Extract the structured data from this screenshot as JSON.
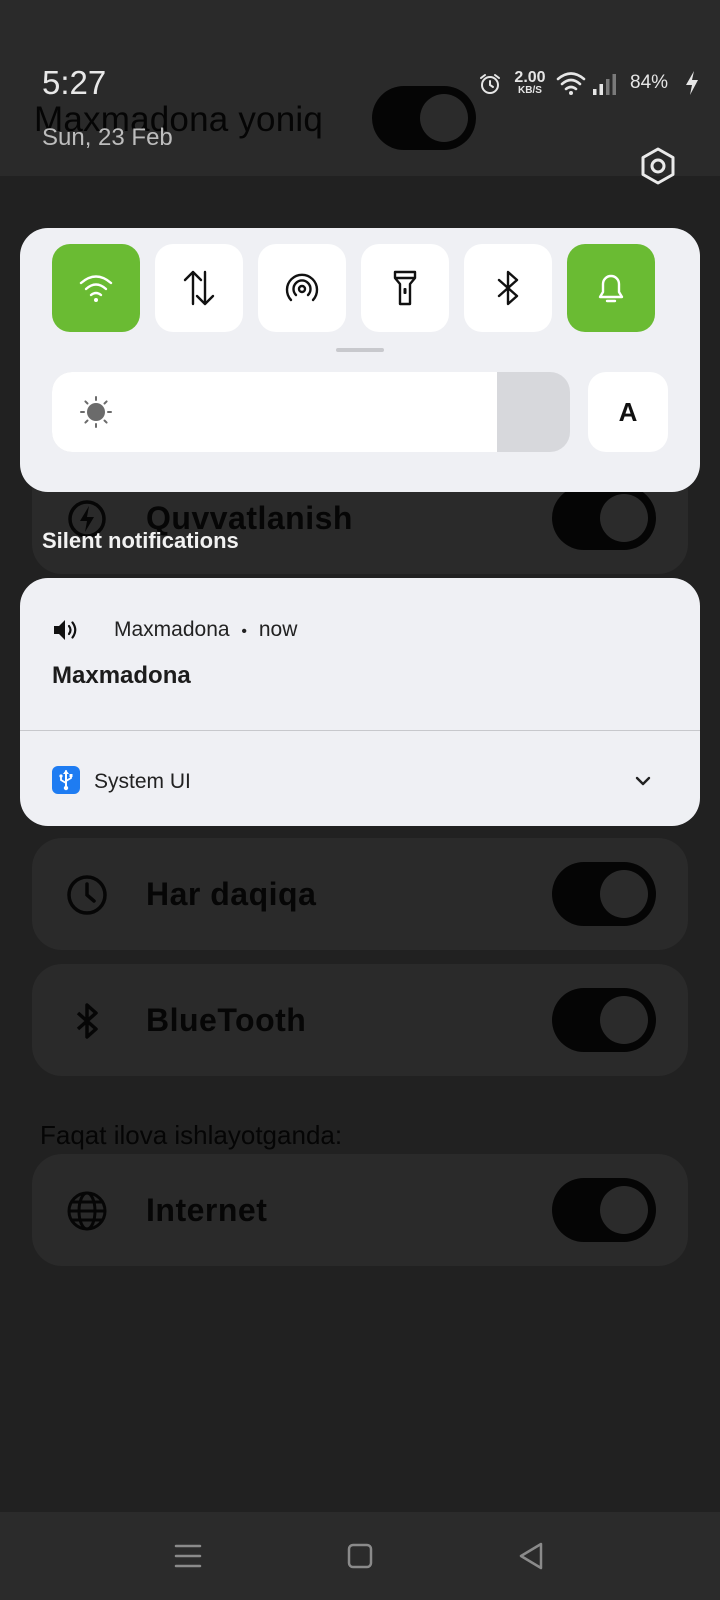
{
  "status_bar": {
    "time": "5:27",
    "date": "Sun, 23 Feb",
    "net_speed_value": "2.00",
    "net_speed_unit": "KB/S",
    "battery": "84%",
    "icons": [
      "alarm-icon",
      "wifi-icon",
      "signal-icon",
      "charging-icon"
    ]
  },
  "app": {
    "title": "Maxmadona yoniq",
    "cards": [
      {
        "label": "Quvvatlanish",
        "icon": "power-icon",
        "enabled": true
      },
      {
        "label": "Har daqiqa",
        "icon": "clock-icon",
        "enabled": true
      },
      {
        "label": "BlueTooth",
        "icon": "bluetooth-icon",
        "enabled": true
      },
      {
        "label": "Internet",
        "icon": "globe-icon",
        "enabled": true
      }
    ],
    "section_note": "Faqat ilova ishlayotganda:",
    "main_toggle_enabled": true
  },
  "quick_settings": {
    "tiles": [
      {
        "name": "wifi",
        "icon": "wifi-icon",
        "active": true
      },
      {
        "name": "mobile-data",
        "icon": "data-arrows-icon",
        "active": false
      },
      {
        "name": "hotspot",
        "icon": "hotspot-icon",
        "active": false
      },
      {
        "name": "flashlight",
        "icon": "flashlight-icon",
        "active": false
      },
      {
        "name": "bluetooth",
        "icon": "bluetooth-icon",
        "active": false
      },
      {
        "name": "sound",
        "icon": "bell-icon",
        "active": true
      }
    ],
    "brightness_level": 0.86,
    "auto_brightness_label": "A",
    "active_color": "#6abb33"
  },
  "notifications": {
    "section_title": "Silent notifications",
    "items": [
      {
        "app": "Maxmadona",
        "separator": "•",
        "time": "now",
        "title": "Maxmadona",
        "icon": "speaker-icon"
      }
    ],
    "group": {
      "app": "System UI",
      "icon": "usb-icon",
      "expand_icon": "chevron-down-icon"
    }
  },
  "navbar": {
    "buttons": [
      "menu-icon",
      "home-icon",
      "back-icon"
    ]
  }
}
